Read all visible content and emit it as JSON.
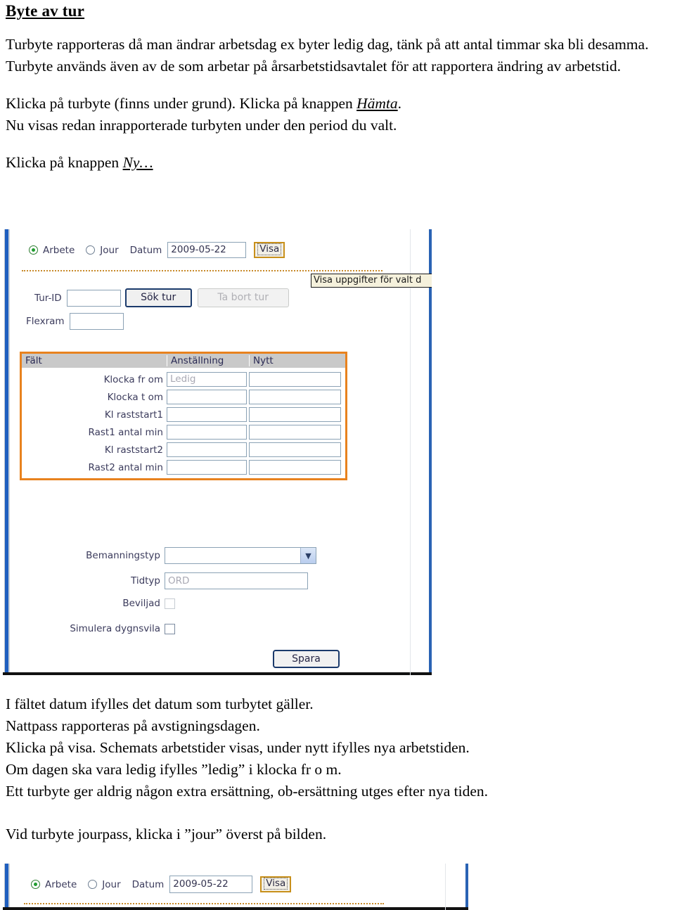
{
  "document": {
    "title": "Byte av tur",
    "paragraph1": "Turbyte rapporteras då man ändrar arbetsdag ex byter ledig dag, tänk på att antal timmar ska bli desamma. Turbyte används även av de som arbetar på årsarbetstidsavtalet för att rapportera ändring av arbetstid.",
    "paragraph2_line1_prefix": "Klicka på turbyte (finns under grund). Klicka på knappen ",
    "paragraph2_line1_emph": "Hämta",
    "paragraph2_line1_suffix": ".",
    "paragraph2_line2": "Nu visas redan inrapporterade turbyten under den period du valt.",
    "paragraph3_prefix": "Klicka på knappen ",
    "paragraph3_emph": "Ny…",
    "footer_lines": [
      "I fältet datum ifylles det datum som turbytet gäller.",
      "Nattpass rapporteras på avstigningsdagen.",
      "Klicka på visa. Schemats arbetstider visas, under nytt ifylles nya arbetstiden.",
      "Om dagen ska vara ledig ifylles ”ledig” i klocka fr o m.",
      "Ett turbyte ger aldrig någon extra ersättning, ob-ersättning utges efter nya tiden."
    ],
    "footer_last": "Vid turbyte jourpass, klicka i ”jour” överst på bilden."
  },
  "screenshot_main": {
    "radio_arbete": "Arbete",
    "radio_jour": "Jour",
    "datum_label": "Datum",
    "datum_value": "2009-05-22",
    "visa_button": "Visa",
    "tooltip": "Visa uppgifter för valt d",
    "turid_label": "Tur-ID",
    "turid_value": "",
    "sok_tur_button": "Sök tur",
    "ta_bort_tur_button": "Ta bort tur",
    "flexram_label": "Flexram",
    "flexram_value": "",
    "table": {
      "headers": [
        "Fält",
        "Anställning",
        "Nytt"
      ],
      "rows": [
        {
          "label": "Klocka fr om",
          "anstallning": "Ledig",
          "anstallning_is_placeholder": true,
          "nytt": ""
        },
        {
          "label": "Klocka t om",
          "anstallning": "",
          "anstallning_is_placeholder": false,
          "nytt": ""
        },
        {
          "label": "Kl raststart1",
          "anstallning": "",
          "anstallning_is_placeholder": false,
          "nytt": ""
        },
        {
          "label": "Rast1 antal min",
          "anstallning": "",
          "anstallning_is_placeholder": false,
          "nytt": ""
        },
        {
          "label": "Kl raststart2",
          "anstallning": "",
          "anstallning_is_placeholder": false,
          "nytt": ""
        },
        {
          "label": "Rast2 antal min",
          "anstallning": "",
          "anstallning_is_placeholder": false,
          "nytt": ""
        }
      ]
    },
    "bemanningstyp_label": "Bemanningstyp",
    "bemanningstyp_value": "",
    "tidtyp_label": "Tidtyp",
    "tidtyp_value": "ORD",
    "beviljad_label": "Beviljad",
    "beviljad_checked": false,
    "simulera_label": "Simulera dygnsvila",
    "simulera_checked": false,
    "spara_button": "Spara"
  },
  "screenshot_bottom": {
    "radio_arbete": "Arbete",
    "radio_jour": "Jour",
    "datum_label": "Datum",
    "datum_value": "2009-05-22",
    "visa_button": "Visa"
  },
  "colors": {
    "accent_orange": "#e8821e",
    "window_blue": "#2a63b4",
    "header_gray": "#c9c9c9",
    "radio_green": "#1f9d2f",
    "button_border": "#1b3a6b",
    "visa_border": "#c8901b",
    "tooltip_bg": "#f5f1dc"
  }
}
